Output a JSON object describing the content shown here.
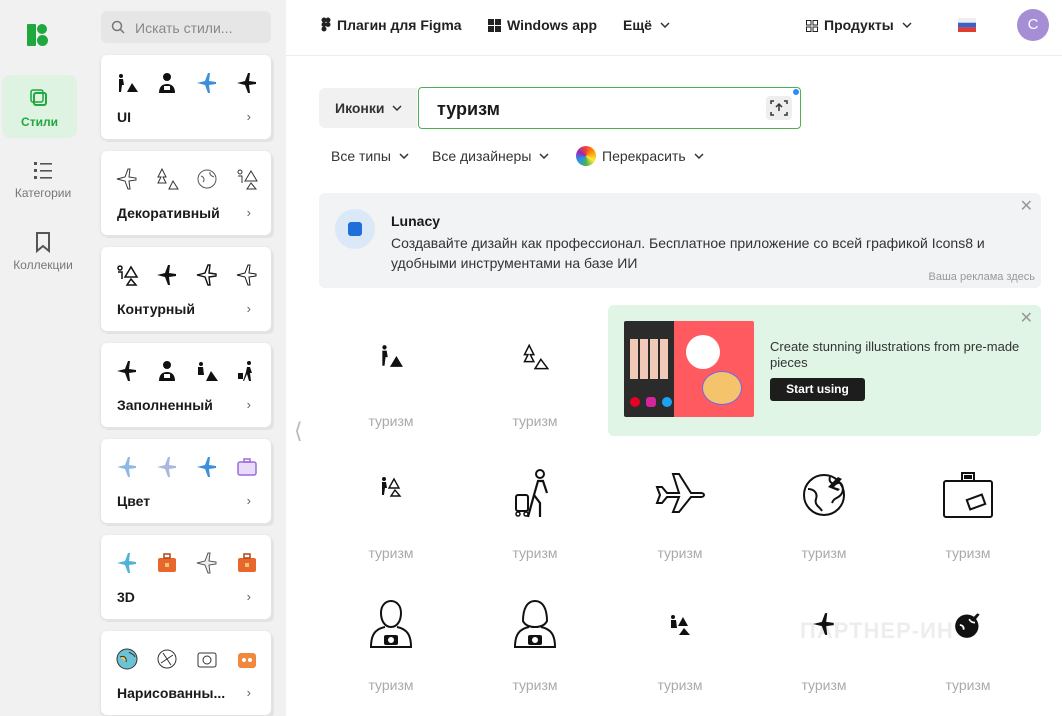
{
  "rail": {
    "styles_label": "Стили",
    "categories_label": "Категории",
    "collections_label": "Коллекции"
  },
  "sidebar": {
    "search_placeholder": "Искать стили...",
    "cards": [
      {
        "label": "UI"
      },
      {
        "label": "Декоративный"
      },
      {
        "label": "Контурный"
      },
      {
        "label": "Заполненный"
      },
      {
        "label": "Цвет"
      },
      {
        "label": "3D"
      },
      {
        "label": "Нарисованны..."
      }
    ]
  },
  "topnav": {
    "figma": "Плагин для Figma",
    "windows": "Windows app",
    "more": "Ещё",
    "products": "Продукты",
    "avatar": "C"
  },
  "search": {
    "type": "Иконки",
    "query": "туризм"
  },
  "filters": {
    "types": "Все типы",
    "designers": "Все дизайнеры",
    "recolor": "Перекрасить"
  },
  "ad": {
    "title": "Lunacy",
    "text": "Создавайте дизайн как профессионал. Бесплатное приложение со всей графикой Icons8 и удобными инструментами на базе ИИ",
    "note": "Ваша реклама здесь"
  },
  "promo": {
    "text": "Create stunning illustrations from pre-made pieces",
    "button": "Start using"
  },
  "results": [
    {
      "caption": "туризм",
      "icon": "hiker-tent-icon"
    },
    {
      "caption": "туризм",
      "icon": "tree-tent-icon"
    },
    {
      "caption": "туризм",
      "icon": "hiker-tree-small-icon"
    },
    {
      "caption": "туризм",
      "icon": "traveler-suitcase-icon"
    },
    {
      "caption": "туризм",
      "icon": "airplane-outline-icon"
    },
    {
      "caption": "туризм",
      "icon": "globe-plane-icon"
    },
    {
      "caption": "туризм",
      "icon": "suitcase-icon"
    },
    {
      "caption": "туризм",
      "icon": "man-camera-icon"
    },
    {
      "caption": "туризм",
      "icon": "woman-camera-icon"
    },
    {
      "caption": "туризм",
      "icon": "hiker-tent-filled-icon"
    },
    {
      "caption": "туризм",
      "icon": "airplane-filled-icon"
    },
    {
      "caption": "туризм",
      "icon": "globe-filled-icon"
    }
  ],
  "watermark": "ПАРТНЕР-ИН",
  "colors": {
    "accent_green": "#1fa83d",
    "search_border": "#4caf50",
    "avatar": "#a58ed6",
    "plane_blue": "#3d8fd9"
  }
}
